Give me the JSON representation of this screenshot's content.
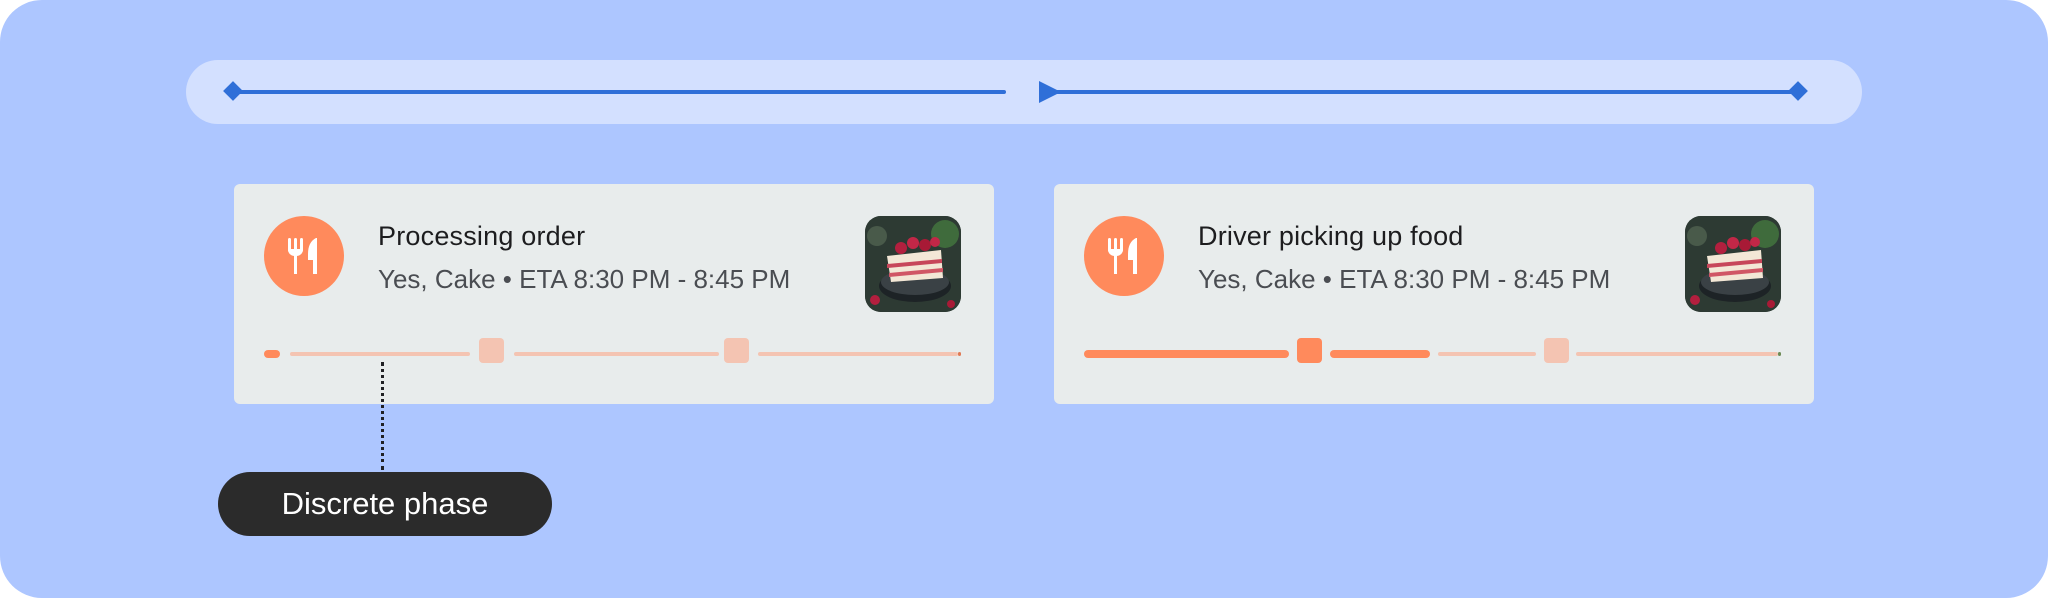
{
  "timeline": {
    "start_marker_icon": "diamond-icon",
    "playhead_icon": "play-icon",
    "end_marker_icon": "diamond-icon",
    "accent_color": "#2f6fd8"
  },
  "cards": [
    {
      "icon": "restaurant-icon",
      "title": "Processing order",
      "subtitle": "Yes, Cake • ETA 8:30 PM - 8:45 PM",
      "image": "cake-thumbnail"
    },
    {
      "icon": "restaurant-icon",
      "title": "Driver picking up food",
      "subtitle": "Yes, Cake • ETA 8:30 PM - 8:45 PM",
      "image": "cake-thumbnail"
    }
  ],
  "callout": {
    "label": "Discrete phase"
  },
  "colors": {
    "background": "#adc6ff",
    "card": "#e8ecec",
    "progress_active": "#ff8a5c",
    "progress_inactive": "#f4c4b2",
    "callout": "#2b2b2b"
  }
}
